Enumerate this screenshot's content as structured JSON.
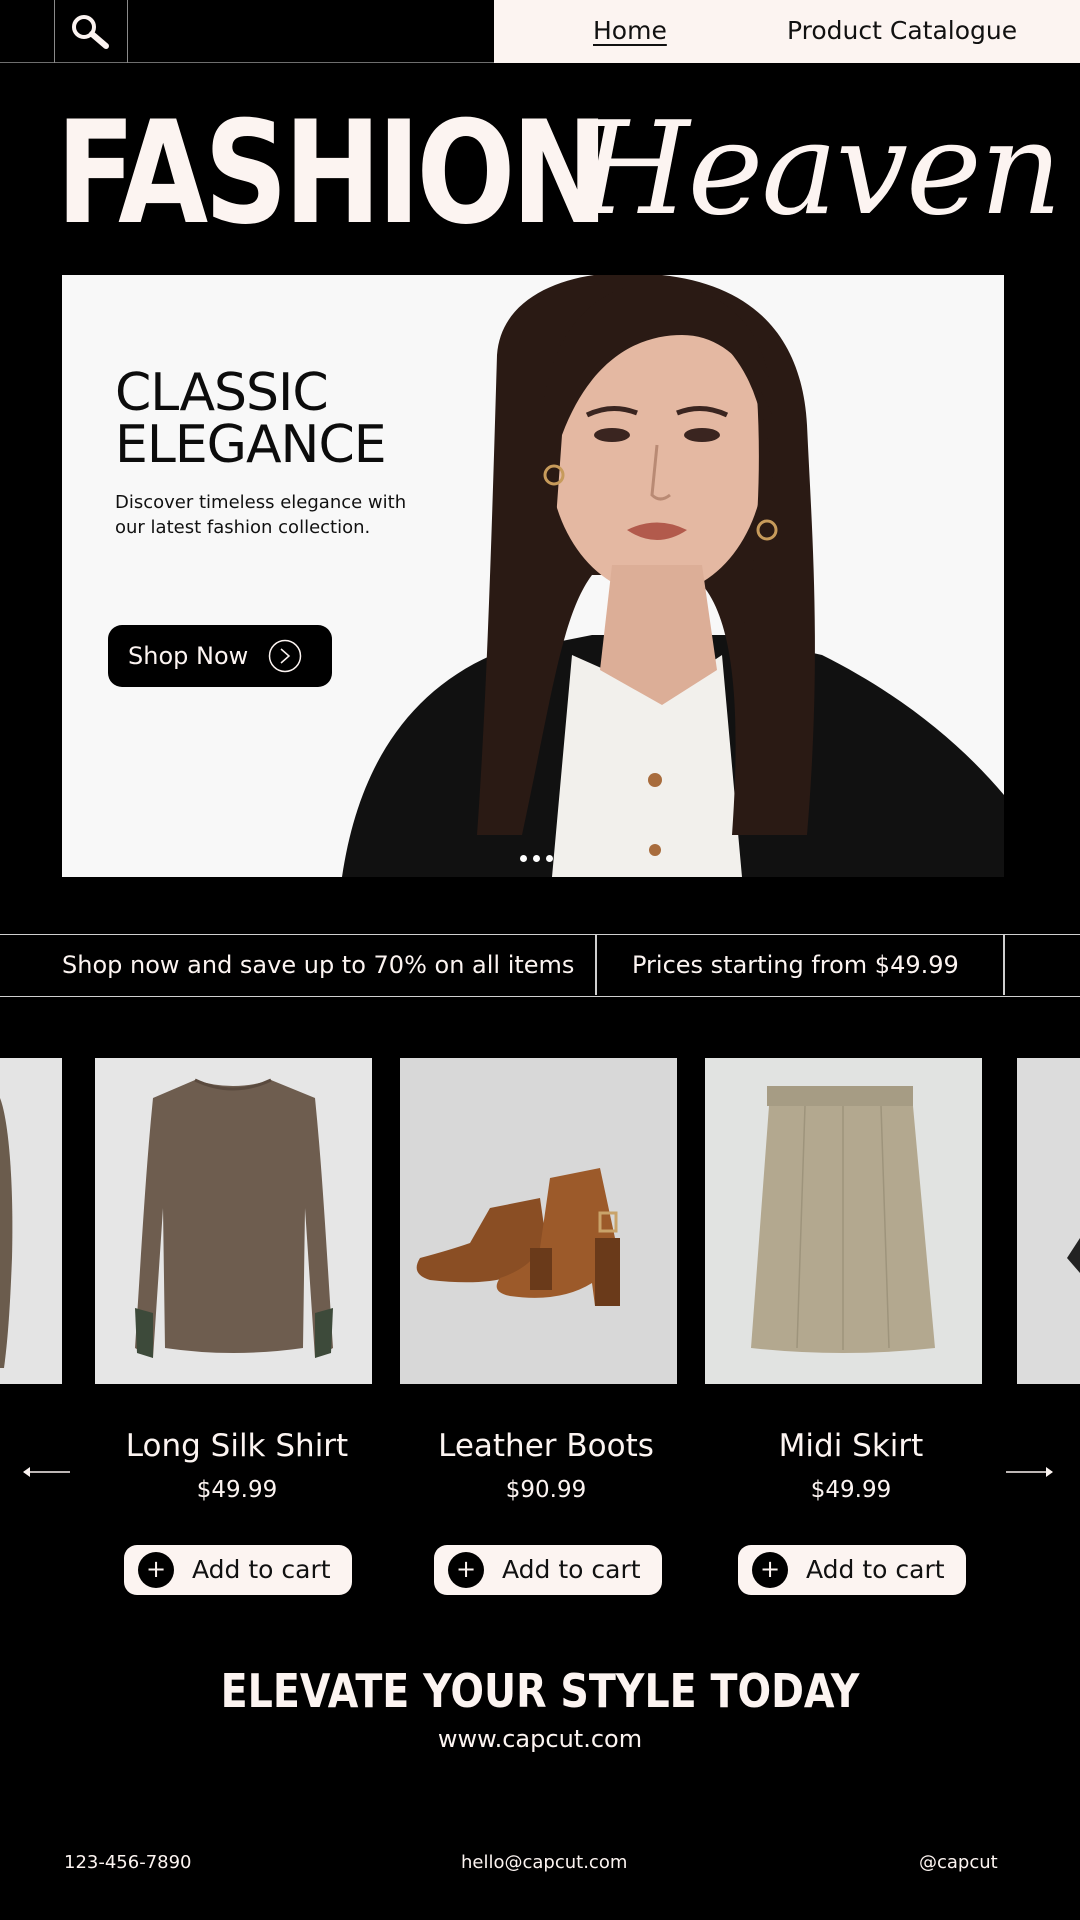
{
  "nav": {
    "search_icon": "search-icon",
    "links": [
      "Home",
      "Product Catalogue"
    ]
  },
  "hero": {
    "title_bold": "FASHION",
    "title_script": "Heaven"
  },
  "banner": {
    "heading": "CLASSIC\nELEGANCE",
    "text": "Discover timeless elegance with our latest fashion collection.",
    "button_label": "Shop Now",
    "button_icon": "chevron-right-circle-icon",
    "slide_count": 3
  },
  "promo": {
    "left": "Shop now and save up to 70% on all items",
    "right": "Prices starting from $49.99"
  },
  "products": [
    {
      "name": "Long Silk Shirt",
      "price": "$49.99",
      "cart_label": "Add to cart"
    },
    {
      "name": "Leather Boots",
      "price": "$90.99",
      "cart_label": "Add to cart"
    },
    {
      "name": "Midi Skirt",
      "price": "$49.99",
      "cart_label": "Add to cart"
    }
  ],
  "carousel": {
    "prev_icon": "arrow-left-icon",
    "next_icon": "arrow-right-icon"
  },
  "footer": {
    "cta": "ELEVATE YOUR STYLE TODAY",
    "website": "www.capcut.com",
    "phone": "123-456-7890",
    "email": "hello@capcut.com",
    "handle": "@capcut"
  },
  "colors": {
    "background": "#000000",
    "cream": "#fcf4f1",
    "banner_bg": "#f8f8f8"
  }
}
